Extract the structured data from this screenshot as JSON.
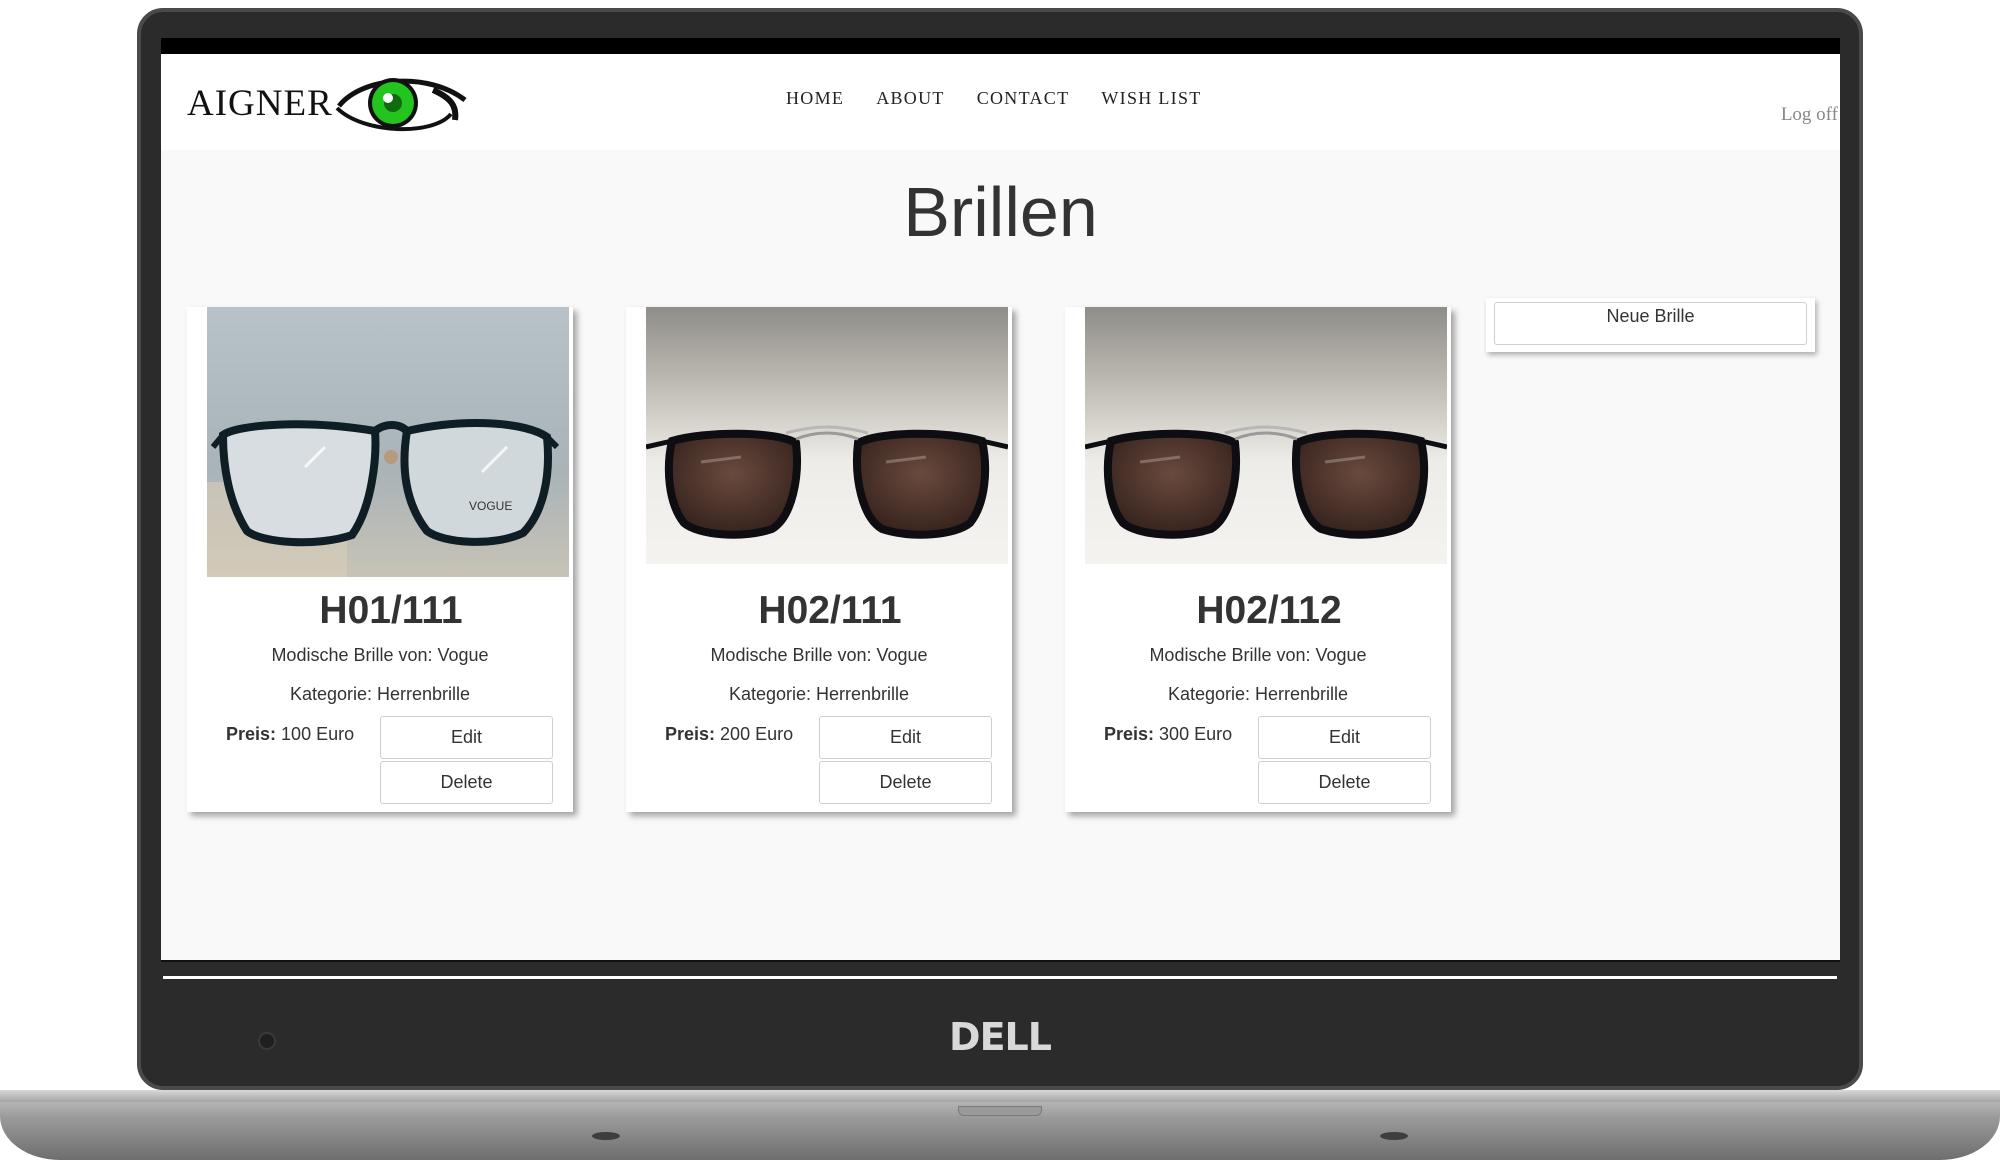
{
  "device": {
    "brand": "DELL"
  },
  "header": {
    "logo_text": "AIGNER",
    "nav": [
      {
        "label": "HOME"
      },
      {
        "label": "ABOUT"
      },
      {
        "label": "CONTACT"
      },
      {
        "label": "WISH LIST"
      }
    ],
    "logoff_label": "Log off"
  },
  "page": {
    "title": "Brillen",
    "new_button_label": "Neue Brille"
  },
  "products": [
    {
      "code": "H01/111",
      "description": "Modische Brille von: Vogue",
      "category": "Kategorie: Herrenbrille",
      "price_label": "Preis:",
      "price_value": "100 Euro",
      "edit_label": "Edit",
      "delete_label": "Delete"
    },
    {
      "code": "H02/111",
      "description": "Modische Brille von: Vogue",
      "category": "Kategorie: Herrenbrille",
      "price_label": "Preis:",
      "price_value": "200 Euro",
      "edit_label": "Edit",
      "delete_label": "Delete"
    },
    {
      "code": "H02/112",
      "description": "Modische Brille von: Vogue",
      "category": "Kategorie: Herrenbrille",
      "price_label": "Preis:",
      "price_value": "300 Euro",
      "edit_label": "Edit",
      "delete_label": "Delete"
    }
  ],
  "colors": {
    "eye_green": "#22c41d",
    "page_bg": "#f9f9f9",
    "text": "#333333"
  }
}
